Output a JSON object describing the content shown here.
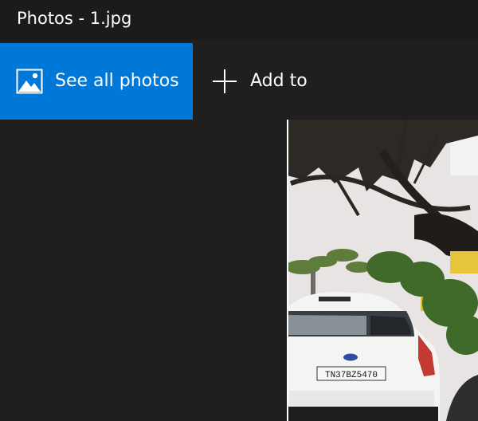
{
  "window": {
    "title": "Photos - 1.jpg"
  },
  "toolbar": {
    "see_all_label": "See all photos",
    "see_all_icon": "photo-library-icon",
    "add_label": "Add to",
    "add_icon": "plus-icon"
  },
  "photo": {
    "plate_text": "TN37BZ5470"
  },
  "colors": {
    "accent": "#0078d7",
    "background": "#1f1f1f",
    "titlebar": "#1b1b1b",
    "text": "#ffffff"
  }
}
